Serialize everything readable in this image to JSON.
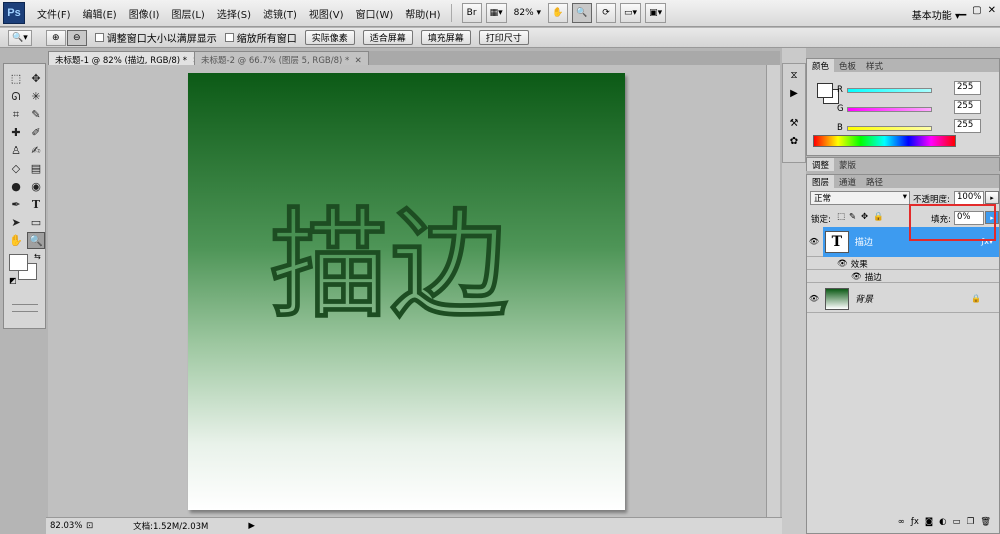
{
  "app": {
    "logo": "Ps",
    "menu": [
      "文件(F)",
      "编辑(E)",
      "图像(I)",
      "图层(L)",
      "选择(S)",
      "滤镜(T)",
      "视图(V)",
      "窗口(W)",
      "帮助(H)"
    ],
    "bridge_label": "Br",
    "zoom": "82%",
    "workspace": "基本功能"
  },
  "options_bar": {
    "resize_windows_label": "调整窗口大小以满屏显示",
    "zoom_all_windows_label": "缩放所有窗口",
    "actual_pixels": "实际像素",
    "fit_screen": "适合屏幕",
    "fill_screen": "填充屏幕",
    "print_size": "打印尺寸"
  },
  "documents": {
    "tabs": [
      {
        "label": "未标题-1 @ 82% (描边, RGB/8) *",
        "active": true
      },
      {
        "label": "未标题-2 @ 66.7% (图层 5, RGB/8) *",
        "active": false
      }
    ],
    "canvas_text": "描边"
  },
  "status": {
    "zoom": "82.03%",
    "doc_info": "文档:1.52M/2.03M"
  },
  "color_panel": {
    "tabs": [
      "颜色",
      "色板",
      "样式"
    ],
    "channels": [
      {
        "label": "R",
        "value": "255",
        "color": "#00e5e5"
      },
      {
        "label": "G",
        "value": "255",
        "color": "#ff33ff"
      },
      {
        "label": "B",
        "value": "255",
        "color": "#ffff00"
      }
    ]
  },
  "adjust_panel": {
    "tabs": [
      "调整",
      "蒙版"
    ]
  },
  "layers_panel": {
    "tabs": [
      "图层",
      "通道",
      "路径"
    ],
    "blend_mode": "正常",
    "opacity_label": "不透明度:",
    "opacity_value": "100%",
    "lock_label": "锁定:",
    "fill_label": "填充:",
    "fill_value": "0%",
    "layers": [
      {
        "name": "描边",
        "thumb": "T",
        "selected": true
      },
      {
        "name": "效果",
        "type": "effects-group"
      },
      {
        "name": "描边",
        "type": "effect"
      },
      {
        "name": "背景",
        "thumb": "gradient",
        "selected": false
      }
    ]
  },
  "colors": {
    "highlight": "#e32a2a",
    "selected_layer": "#3d9bf0"
  }
}
